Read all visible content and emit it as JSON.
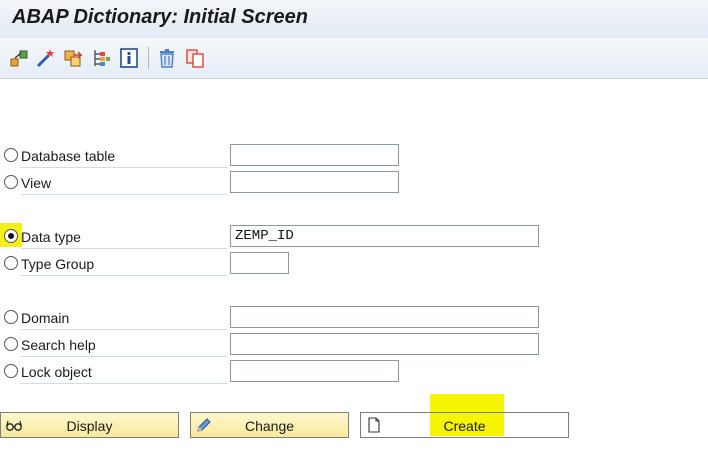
{
  "window": {
    "title": "ABAP Dictionary: Initial Screen"
  },
  "toolbar": {
    "icons": [
      "other-object-icon",
      "check-wand-icon",
      "activate-icon",
      "where-used-icon",
      "info-icon",
      "delete-icon",
      "copy-icon"
    ]
  },
  "form": {
    "rows": [
      {
        "label": "Database table",
        "value": "",
        "checked": false
      },
      {
        "label": "View",
        "value": "",
        "checked": false
      },
      {
        "label": "Data type",
        "value": "ZEMP_ID",
        "checked": true
      },
      {
        "label": "Type Group",
        "value": "",
        "checked": false
      },
      {
        "label": "Domain",
        "value": "",
        "checked": false
      },
      {
        "label": "Search help",
        "value": "",
        "checked": false
      },
      {
        "label": "Lock object",
        "value": "",
        "checked": false
      }
    ]
  },
  "buttons": {
    "display": "Display",
    "change": "Change",
    "create": "Create"
  },
  "colors": {
    "highlight": "#f6f400",
    "button_fill": "#f7e99a",
    "title_bar": "#e3eaf3"
  }
}
